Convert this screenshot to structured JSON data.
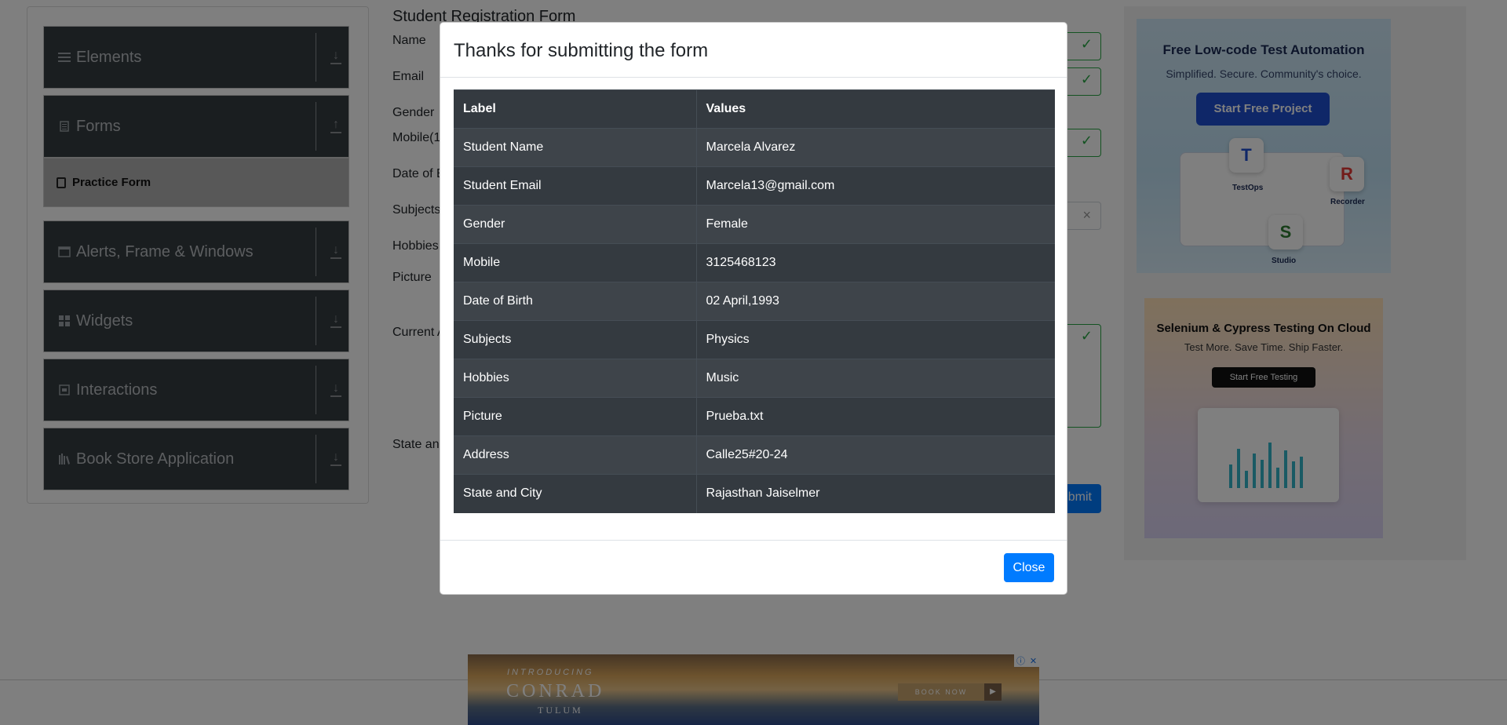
{
  "sidebar": {
    "groups": [
      {
        "label": "Elements",
        "icon": "hamburger-icon",
        "arrow": "download-icon"
      },
      {
        "label": "Forms",
        "icon": "document-icon",
        "arrow": "upload-icon"
      },
      {
        "label": "Alerts, Frame & Windows",
        "icon": "window-icon",
        "arrow": "download-icon"
      },
      {
        "label": "Widgets",
        "icon": "widgets-icon",
        "arrow": "download-icon"
      },
      {
        "label": "Interactions",
        "icon": "interactions-icon",
        "arrow": "download-icon"
      },
      {
        "label": "Book Store Application",
        "icon": "books-icon",
        "arrow": "download-icon"
      }
    ],
    "active_item": "Practice Form"
  },
  "form": {
    "title": "Student Registration Form",
    "labels": {
      "name": "Name",
      "email": "Email",
      "gender": "Gender",
      "mobile": "Mobile(1",
      "dob": "Date of B",
      "subjects": "Subjects",
      "hobbies": "Hobbies",
      "picture": "Picture",
      "current_address": "Current A",
      "state_city": "State and"
    },
    "submit_partial": "bmit"
  },
  "ads": {
    "right_top": {
      "title": "Free Low-code Test Automation",
      "subtitle": "Simplified. Secure. Community's choice.",
      "button": "Start Free Project",
      "tiles": {
        "testops": "TestOps",
        "recorder": "Recorder",
        "studio": "Studio"
      }
    },
    "right_bottom": {
      "title": "Selenium & Cypress Testing On Cloud",
      "subtitle": "Test More. Save Time. Ship Faster.",
      "button": "Start Free Testing"
    },
    "bottom": {
      "intro": "INTRODUCING",
      "brand": "CONRAD",
      "place": "TULUM",
      "cta": "BOOK NOW"
    }
  },
  "modal": {
    "title": "Thanks for submitting the form",
    "headers": [
      "Label",
      "Values"
    ],
    "rows": [
      [
        "Student Name",
        "Marcela Alvarez"
      ],
      [
        "Student Email",
        "Marcela13@gmail.com"
      ],
      [
        "Gender",
        "Female"
      ],
      [
        "Mobile",
        "3125468123"
      ],
      [
        "Date of Birth",
        "02 April,1993"
      ],
      [
        "Subjects",
        "Physics"
      ],
      [
        "Hobbies",
        "Music"
      ],
      [
        "Picture",
        "Prueba.txt"
      ],
      [
        "Address",
        "Calle25#20-24"
      ],
      [
        "State and City",
        "Rajasthan Jaiselmer"
      ]
    ],
    "close_label": "Close"
  }
}
